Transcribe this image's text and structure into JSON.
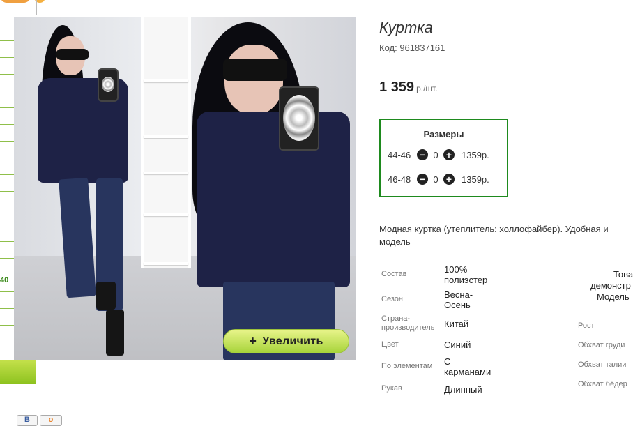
{
  "product": {
    "title": "Куртка",
    "code": "Код: 961837161",
    "price": "1 359",
    "price_unit": "р./шт."
  },
  "zoom_button": {
    "icon": "+",
    "label": "Увеличить"
  },
  "sizes": {
    "header": "Размеры",
    "rows": [
      {
        "label": "44-46",
        "qty": "0",
        "price": "1359р."
      },
      {
        "label": "46-48",
        "qty": "0",
        "price": "1359р."
      }
    ]
  },
  "description": {
    "line1": "Модная куртка (утеплитель: холлофайбер). Удобная и",
    "line2": "модель"
  },
  "specs": [
    {
      "key": "Состав",
      "value_lines": [
        "100%",
        "полиэстер"
      ]
    },
    {
      "key": "Сезон",
      "value_lines": [
        "Весна-",
        "Осень"
      ]
    },
    {
      "key_lines": [
        "Страна-",
        "производитель"
      ],
      "value_lines": [
        "Китай"
      ]
    },
    {
      "key": "Цвет",
      "value_lines": [
        "Синий"
      ]
    },
    {
      "key": "По элементам",
      "value_lines": [
        "С",
        "карманами"
      ]
    },
    {
      "key": "Рукав",
      "value_lines": [
        "Длинный"
      ]
    }
  ],
  "right_column": {
    "text_lines": [
      "Това",
      "демонстр",
      "Модель"
    ],
    "labels": [
      "Рост",
      "Обхват груди",
      "Обхват талии",
      "Обхват бёдер"
    ]
  },
  "ruler_label": "40",
  "social": [
    "В",
    "о"
  ],
  "colors": {
    "accent_green": "#1e8a1e",
    "button_gradient_top": "#e8f48a",
    "button_gradient_bottom": "#a7d43a"
  }
}
